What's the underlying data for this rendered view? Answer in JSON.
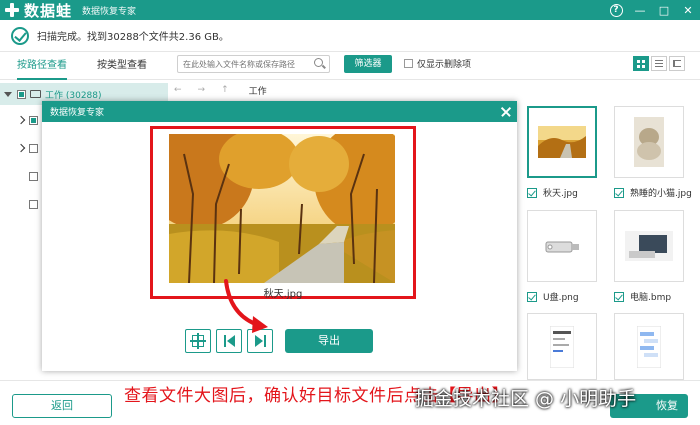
{
  "app": {
    "logo_text": "数据蛙",
    "subtitle": "数据恢复专家"
  },
  "window_buttons": {
    "help": "?",
    "minimize": "—",
    "maximize": "□",
    "close": "✕"
  },
  "status": {
    "text": "扫描完成。找到30288个文件共2.36 GB。"
  },
  "tabs": [
    {
      "label": "按路径查看",
      "active": true
    },
    {
      "label": "按类型查看",
      "active": false
    }
  ],
  "search": {
    "placeholder": "在此处输入文件名称或保存路径"
  },
  "filter_button": "筛选器",
  "only_deleted_label": "仅显示删除项",
  "tree": {
    "root_label": "工作 (30288)"
  },
  "nav": {
    "back": "←",
    "forward": "→",
    "up": "↑",
    "path": "工作"
  },
  "thumbnails": [
    {
      "label": "秋天.jpg",
      "checked": true,
      "selected": true
    },
    {
      "label": "熟睡的小猫.jpg",
      "checked": true,
      "selected": false
    },
    {
      "label": "U盘.png",
      "checked": true,
      "selected": false
    },
    {
      "label": "电脑.bmp",
      "checked": true,
      "selected": false
    },
    {
      "label": "",
      "checked": false,
      "selected": false
    },
    {
      "label": "",
      "checked": false,
      "selected": false
    }
  ],
  "modal": {
    "title": "数据恢复专家",
    "image_name": "秋天.jpg",
    "export_label": "导出"
  },
  "bottom": {
    "back_label": "返回",
    "recover_label": "恢复"
  },
  "annotation": {
    "caption": "查看文件大图后，确认好目标文件后点击【导出】",
    "watermark": "掘金技术社区 @ 小明助手"
  },
  "colors": {
    "accent": "#1b9a8a",
    "annotation_red": "#e3151b",
    "selected_row": "#d8ecea"
  }
}
